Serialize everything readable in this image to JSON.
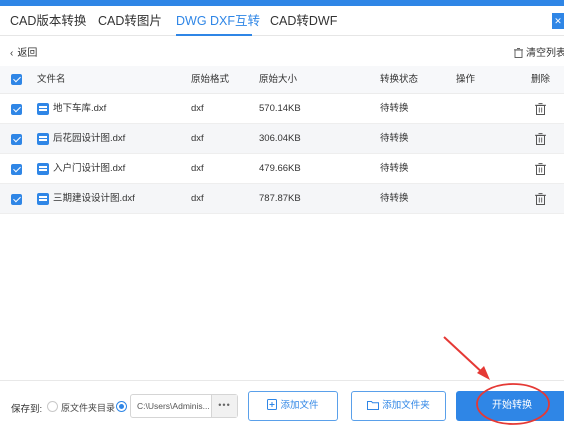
{
  "tabs": [
    {
      "label": "CAD版本转换",
      "active": false
    },
    {
      "label": "CAD转图片",
      "active": false
    },
    {
      "label": "DWG DXF互转",
      "active": true
    },
    {
      "label": "CAD转DWF",
      "active": false
    }
  ],
  "subbar": {
    "back_label": "返回",
    "clear_label": "清空列表"
  },
  "table": {
    "columns": [
      "文件名",
      "原始格式",
      "原始大小",
      "转换状态",
      "操作",
      "删除"
    ],
    "rows": [
      {
        "checked": true,
        "name": "地下车库.dxf",
        "format": "dxf",
        "size": "570.14KB",
        "status": "待转换"
      },
      {
        "checked": true,
        "name": "后花园设计图.dxf",
        "format": "dxf",
        "size": "306.04KB",
        "status": "待转换"
      },
      {
        "checked": true,
        "name": "入户门设计图.dxf",
        "format": "dxf",
        "size": "479.66KB",
        "status": "待转换"
      },
      {
        "checked": true,
        "name": "三期建设设计图.dxf",
        "format": "dxf",
        "size": "787.87KB",
        "status": "待转换"
      }
    ]
  },
  "bottom": {
    "save_to_label": "保存到:",
    "option_source_dir": "原文件夹目录",
    "path_value": "C:\\Users\\Adminis...",
    "path_browse": "•••",
    "add_file_label": "添加文件",
    "add_folder_label": "添加文件夹",
    "start_label": "开始转换"
  },
  "colors": {
    "accent": "#2f86e6",
    "annotation": "#e53935"
  }
}
